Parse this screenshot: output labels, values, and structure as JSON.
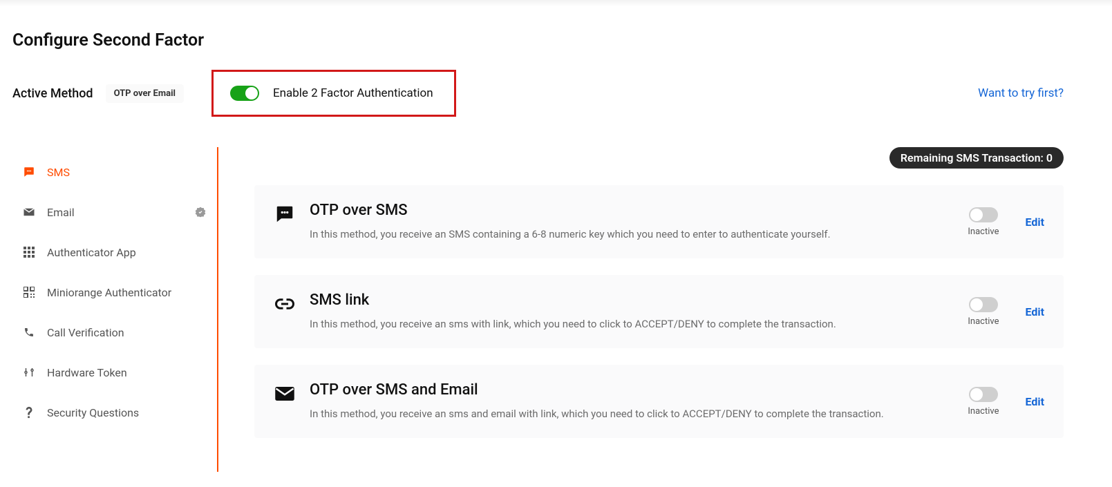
{
  "page_title": "Configure Second Factor",
  "active_method_label": "Active Method",
  "active_method_value": "OTP over Email",
  "enable_toggle_label": "Enable 2 Factor Authentication",
  "try_link": "Want to try first?",
  "remaining_label": "Remaining SMS Transaction: 0",
  "sidebar": {
    "items": [
      {
        "label": "SMS",
        "active": true
      },
      {
        "label": "Email",
        "checked": true
      },
      {
        "label": "Authenticator App"
      },
      {
        "label": "Miniorange Authenticator"
      },
      {
        "label": "Call Verification"
      },
      {
        "label": "Hardware Token"
      },
      {
        "label": "Security Questions"
      }
    ]
  },
  "cards": [
    {
      "title": "OTP over SMS",
      "desc": "In this method, you receive an SMS containing a 6-8 numeric key which you need to enter to authenticate yourself.",
      "status": "Inactive",
      "edit": "Edit"
    },
    {
      "title": "SMS link",
      "desc": "In this method, you receive an sms with link, which you need to click to ACCEPT/DENY to complete the transaction.",
      "status": "Inactive",
      "edit": "Edit"
    },
    {
      "title": "OTP over SMS and Email",
      "desc": "In this method, you receive an sms and email with link, which you need to click to ACCEPT/DENY to complete the transaction.",
      "status": "Inactive",
      "edit": "Edit"
    }
  ]
}
